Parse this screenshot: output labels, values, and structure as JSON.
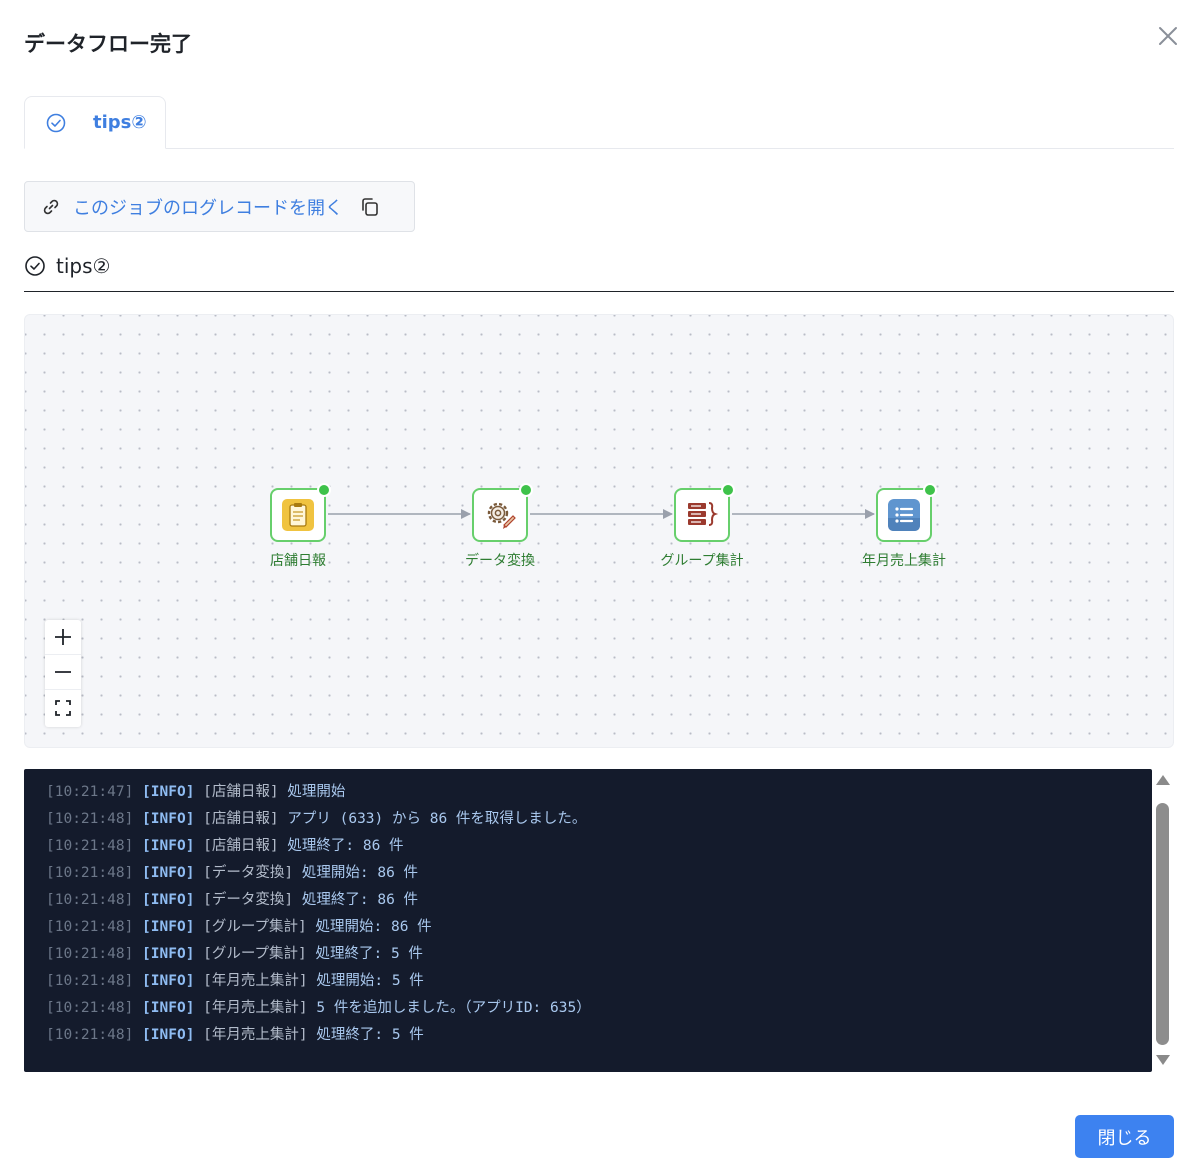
{
  "dialog": {
    "title": "データフロー完了",
    "close_icon": "close-x-icon"
  },
  "tabs": [
    {
      "label": "tips②",
      "icon": "check-circle-icon",
      "active": true
    }
  ],
  "log_link": {
    "text": "このジョブのログレコードを開く",
    "link_icon": "link-icon",
    "copy_icon": "copy-icon"
  },
  "section": {
    "title": "tips②",
    "icon": "check-circle-icon"
  },
  "flow": {
    "nodes": [
      {
        "label": "店舗日報",
        "icon": "clipboard-icon",
        "status": "success"
      },
      {
        "label": "データ変換",
        "icon": "gear-icon",
        "status": "success"
      },
      {
        "label": "グループ集計",
        "icon": "group-aggregate-icon",
        "status": "success"
      },
      {
        "label": "年月売上集計",
        "icon": "list-icon",
        "status": "success"
      }
    ],
    "status_color": "#3ec24a",
    "border_color": "#67cf6c",
    "zoom_controls": [
      "zoom-in-icon",
      "zoom-out-icon",
      "fit-view-icon"
    ]
  },
  "logs": [
    {
      "time": "[10:21:47]",
      "level": "[INFO]",
      "source": "[店舗日報]",
      "message": "処理開始"
    },
    {
      "time": "[10:21:48]",
      "level": "[INFO]",
      "source": "[店舗日報]",
      "message": "アプリ (633) から 86 件を取得しました。"
    },
    {
      "time": "[10:21:48]",
      "level": "[INFO]",
      "source": "[店舗日報]",
      "message": "処理終了: 86 件"
    },
    {
      "time": "[10:21:48]",
      "level": "[INFO]",
      "source": "[データ変換]",
      "message": "処理開始: 86 件"
    },
    {
      "time": "[10:21:48]",
      "level": "[INFO]",
      "source": "[データ変換]",
      "message": "処理終了: 86 件"
    },
    {
      "time": "[10:21:48]",
      "level": "[INFO]",
      "source": "[グループ集計]",
      "message": "処理開始: 86 件"
    },
    {
      "time": "[10:21:48]",
      "level": "[INFO]",
      "source": "[グループ集計]",
      "message": "処理終了: 5 件"
    },
    {
      "time": "[10:21:48]",
      "level": "[INFO]",
      "source": "[年月売上集計]",
      "message": "処理開始: 5 件"
    },
    {
      "time": "[10:21:48]",
      "level": "[INFO]",
      "source": "[年月売上集計]",
      "message": "5 件を追加しました。（アプリID: 635）"
    },
    {
      "time": "[10:21:48]",
      "level": "[INFO]",
      "source": "[年月売上集計]",
      "message": "処理終了: 5 件"
    }
  ],
  "footer": {
    "close_label": "閉じる",
    "accent": "#3d82f0"
  }
}
